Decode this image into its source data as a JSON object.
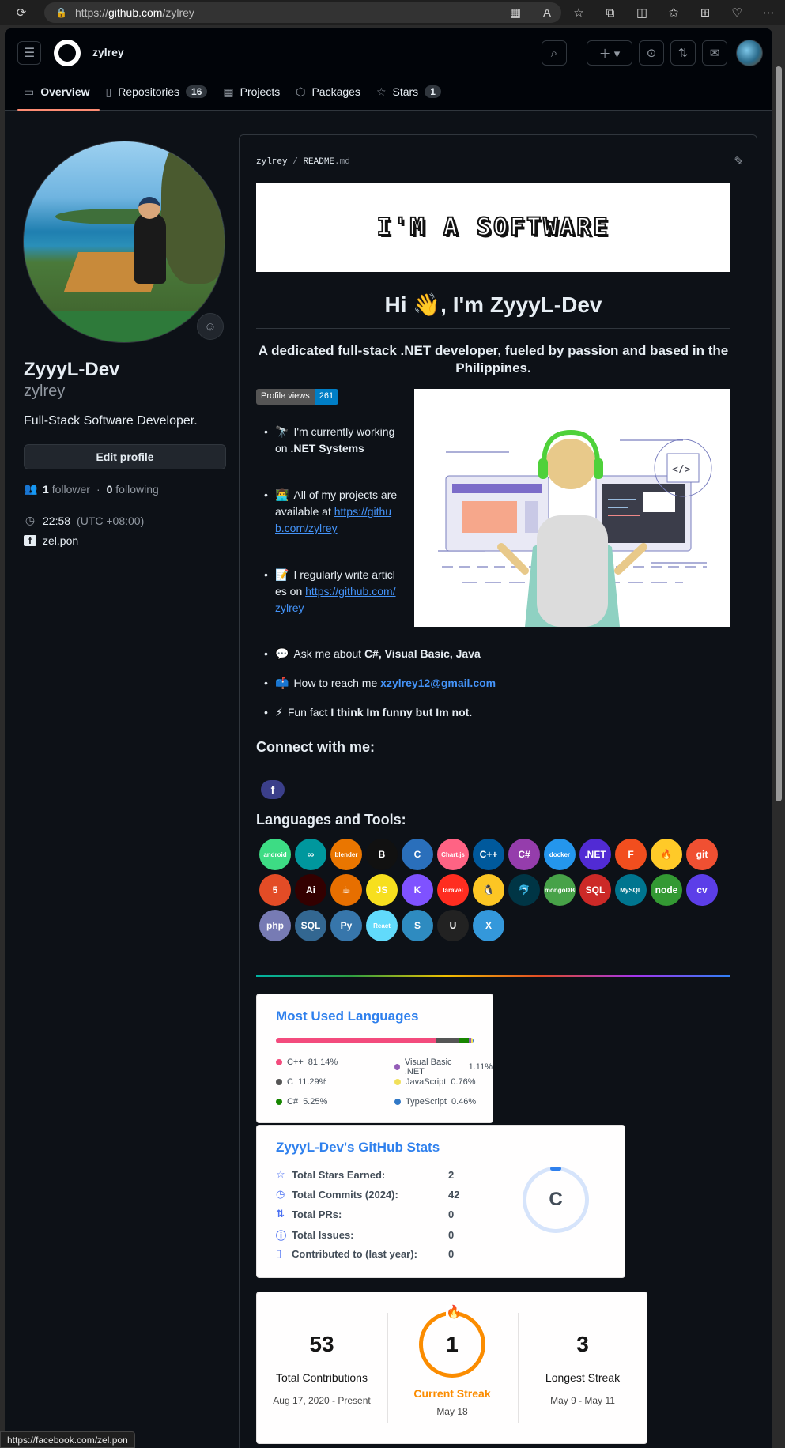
{
  "browser": {
    "url_prefix": "https://",
    "url_host": "github.com",
    "url_path": "/zylrey",
    "status_url": "https://facebook.com/zel.pon"
  },
  "header": {
    "owner": "zylrey",
    "tabs": [
      {
        "label": "Overview",
        "icon": "book-icon"
      },
      {
        "label": "Repositories",
        "icon": "repo-icon",
        "count": "16"
      },
      {
        "label": "Projects",
        "icon": "table-icon"
      },
      {
        "label": "Packages",
        "icon": "package-icon"
      },
      {
        "label": "Stars",
        "icon": "star-icon",
        "count": "1"
      }
    ]
  },
  "profile": {
    "full_name": "ZyyyL-Dev",
    "login": "zylrey",
    "bio": "Full-Stack Software Developer.",
    "edit_label": "Edit profile",
    "followers_count": "1",
    "followers_label": "follower",
    "following_count": "0",
    "following_label": "following",
    "dot": "·",
    "time": "22:58",
    "tz": "(UTC +08:00)",
    "facebook": "zel.pon"
  },
  "readme": {
    "path_owner": "zylrey",
    "path_sep": "/",
    "path_file": "README",
    "path_ext": ".md",
    "banner_text": "I'M A SOFTWARE",
    "greeting": "Hi 👋, I'm ZyyyL-Dev",
    "subtitle": "A dedicated full-stack .NET developer, fueled by passion and based in the Philippines.",
    "views_label": "Profile views",
    "views_count": "261",
    "bullets": [
      {
        "emoji": "🔭",
        "text": "I'm currently working on ",
        "bold": ".NET Systems"
      },
      {
        "emoji": "👨‍💻",
        "text": "All of my projects are available at ",
        "link": "https://github.com/zylrey"
      },
      {
        "emoji": "📝",
        "text": "I regularly write articles on ",
        "link": "https://github.com/zylrey"
      },
      {
        "emoji": "💬",
        "text": "Ask me about ",
        "bold": "C#, Visual Basic, Java"
      },
      {
        "emoji": "📫",
        "text": "How to reach me ",
        "link": "xzylrey12@gmail.com"
      },
      {
        "emoji": "⚡",
        "text": "Fun fact ",
        "bold": "I think Im funny but Im not."
      }
    ],
    "connect_heading": "Connect with me:",
    "fb_glyph": "f",
    "tools_heading": "Languages and Tools:",
    "tools": [
      {
        "name": "android",
        "label": "android",
        "color": "#3ddc84"
      },
      {
        "name": "arduino",
        "label": "∞",
        "color": "#00979d"
      },
      {
        "name": "blender",
        "label": "blender",
        "color": "#ea7600"
      },
      {
        "name": "bootstrap",
        "label": "B",
        "color": "#111111"
      },
      {
        "name": "c",
        "label": "C",
        "color": "#2a6fbb"
      },
      {
        "name": "chartjs",
        "label": "Chart.js",
        "color": "#ff6384"
      },
      {
        "name": "cplusplus",
        "label": "C++",
        "color": "#00599c"
      },
      {
        "name": "csharp",
        "label": "C#",
        "color": "#953dac"
      },
      {
        "name": "docker",
        "label": "docker",
        "color": "#2496ed"
      },
      {
        "name": "dotnet",
        "label": ".NET",
        "color": "#512bd4"
      },
      {
        "name": "figma",
        "label": "F",
        "color": "#f24e1e"
      },
      {
        "name": "firebase",
        "label": "🔥",
        "color": "#ffca28"
      },
      {
        "name": "git",
        "label": "git",
        "color": "#f05032"
      },
      {
        "name": "html5",
        "label": "5",
        "color": "#e34c26"
      },
      {
        "name": "illustrator",
        "label": "Ai",
        "color": "#330000"
      },
      {
        "name": "java",
        "label": "☕",
        "color": "#e76f00"
      },
      {
        "name": "javascript",
        "label": "JS",
        "color": "#f7df1e"
      },
      {
        "name": "kotlin",
        "label": "K",
        "color": "#7f52ff"
      },
      {
        "name": "laravel",
        "label": "laravel",
        "color": "#ff2d20"
      },
      {
        "name": "linux",
        "label": "🐧",
        "color": "#fcc624"
      },
      {
        "name": "mariadb",
        "label": "🐬",
        "color": "#003545"
      },
      {
        "name": "mongodb",
        "label": "mongoDB",
        "color": "#47a248"
      },
      {
        "name": "mssql",
        "label": "SQL",
        "color": "#cc2927"
      },
      {
        "name": "mysql",
        "label": "MySQL",
        "color": "#00758f"
      },
      {
        "name": "nodejs",
        "label": "node",
        "color": "#339933"
      },
      {
        "name": "opencv",
        "label": "cv",
        "color": "#5c3ee8"
      },
      {
        "name": "php",
        "label": "php",
        "color": "#777bb4"
      },
      {
        "name": "postgresql",
        "label": "SQL",
        "color": "#336791"
      },
      {
        "name": "python",
        "label": "Py",
        "color": "#3776ab"
      },
      {
        "name": "react",
        "label": "React",
        "color": "#61dafb"
      },
      {
        "name": "swift",
        "label": "S",
        "color": "#2e8bc0"
      },
      {
        "name": "unity",
        "label": "U",
        "color": "#222222"
      },
      {
        "name": "xamarin",
        "label": "X",
        "color": "#3498db"
      }
    ],
    "langs": {
      "title": "Most Used Languages",
      "items": [
        {
          "name": "C++",
          "pct": "81.14%",
          "value": 81.14,
          "color": "#f34b7d"
        },
        {
          "name": "C",
          "pct": "11.29%",
          "value": 11.29,
          "color": "#555555"
        },
        {
          "name": "C#",
          "pct": "5.25%",
          "value": 5.25,
          "color": "#178600"
        },
        {
          "name": "Visual Basic .NET",
          "pct": "1.11%",
          "value": 1.11,
          "color": "#945db7"
        },
        {
          "name": "JavaScript",
          "pct": "0.76%",
          "value": 0.76,
          "color": "#f1e05a"
        },
        {
          "name": "TypeScript",
          "pct": "0.46%",
          "value": 0.46,
          "color": "#3178c6"
        }
      ]
    },
    "stats": {
      "title": "ZyyyL-Dev's GitHub Stats",
      "rows": [
        {
          "label": "Total Stars Earned:",
          "value": "2",
          "icon": "star-icon"
        },
        {
          "label": "Total Commits (2024):",
          "value": "42",
          "icon": "history-icon"
        },
        {
          "label": "Total PRs:",
          "value": "0",
          "icon": "pull-request-icon"
        },
        {
          "label": "Total Issues:",
          "value": "0",
          "icon": "issue-icon"
        },
        {
          "label": "Contributed to (last year):",
          "value": "0",
          "icon": "repo-icon"
        }
      ],
      "rank": "C"
    },
    "streak": {
      "total": "53",
      "total_label": "Total Contributions",
      "total_range": "Aug 17, 2020 - Present",
      "current": "1",
      "current_label": "Current Streak",
      "current_range": "May 18",
      "longest": "3",
      "longest_label": "Longest Streak",
      "longest_range": "May 9 - May 11"
    }
  }
}
